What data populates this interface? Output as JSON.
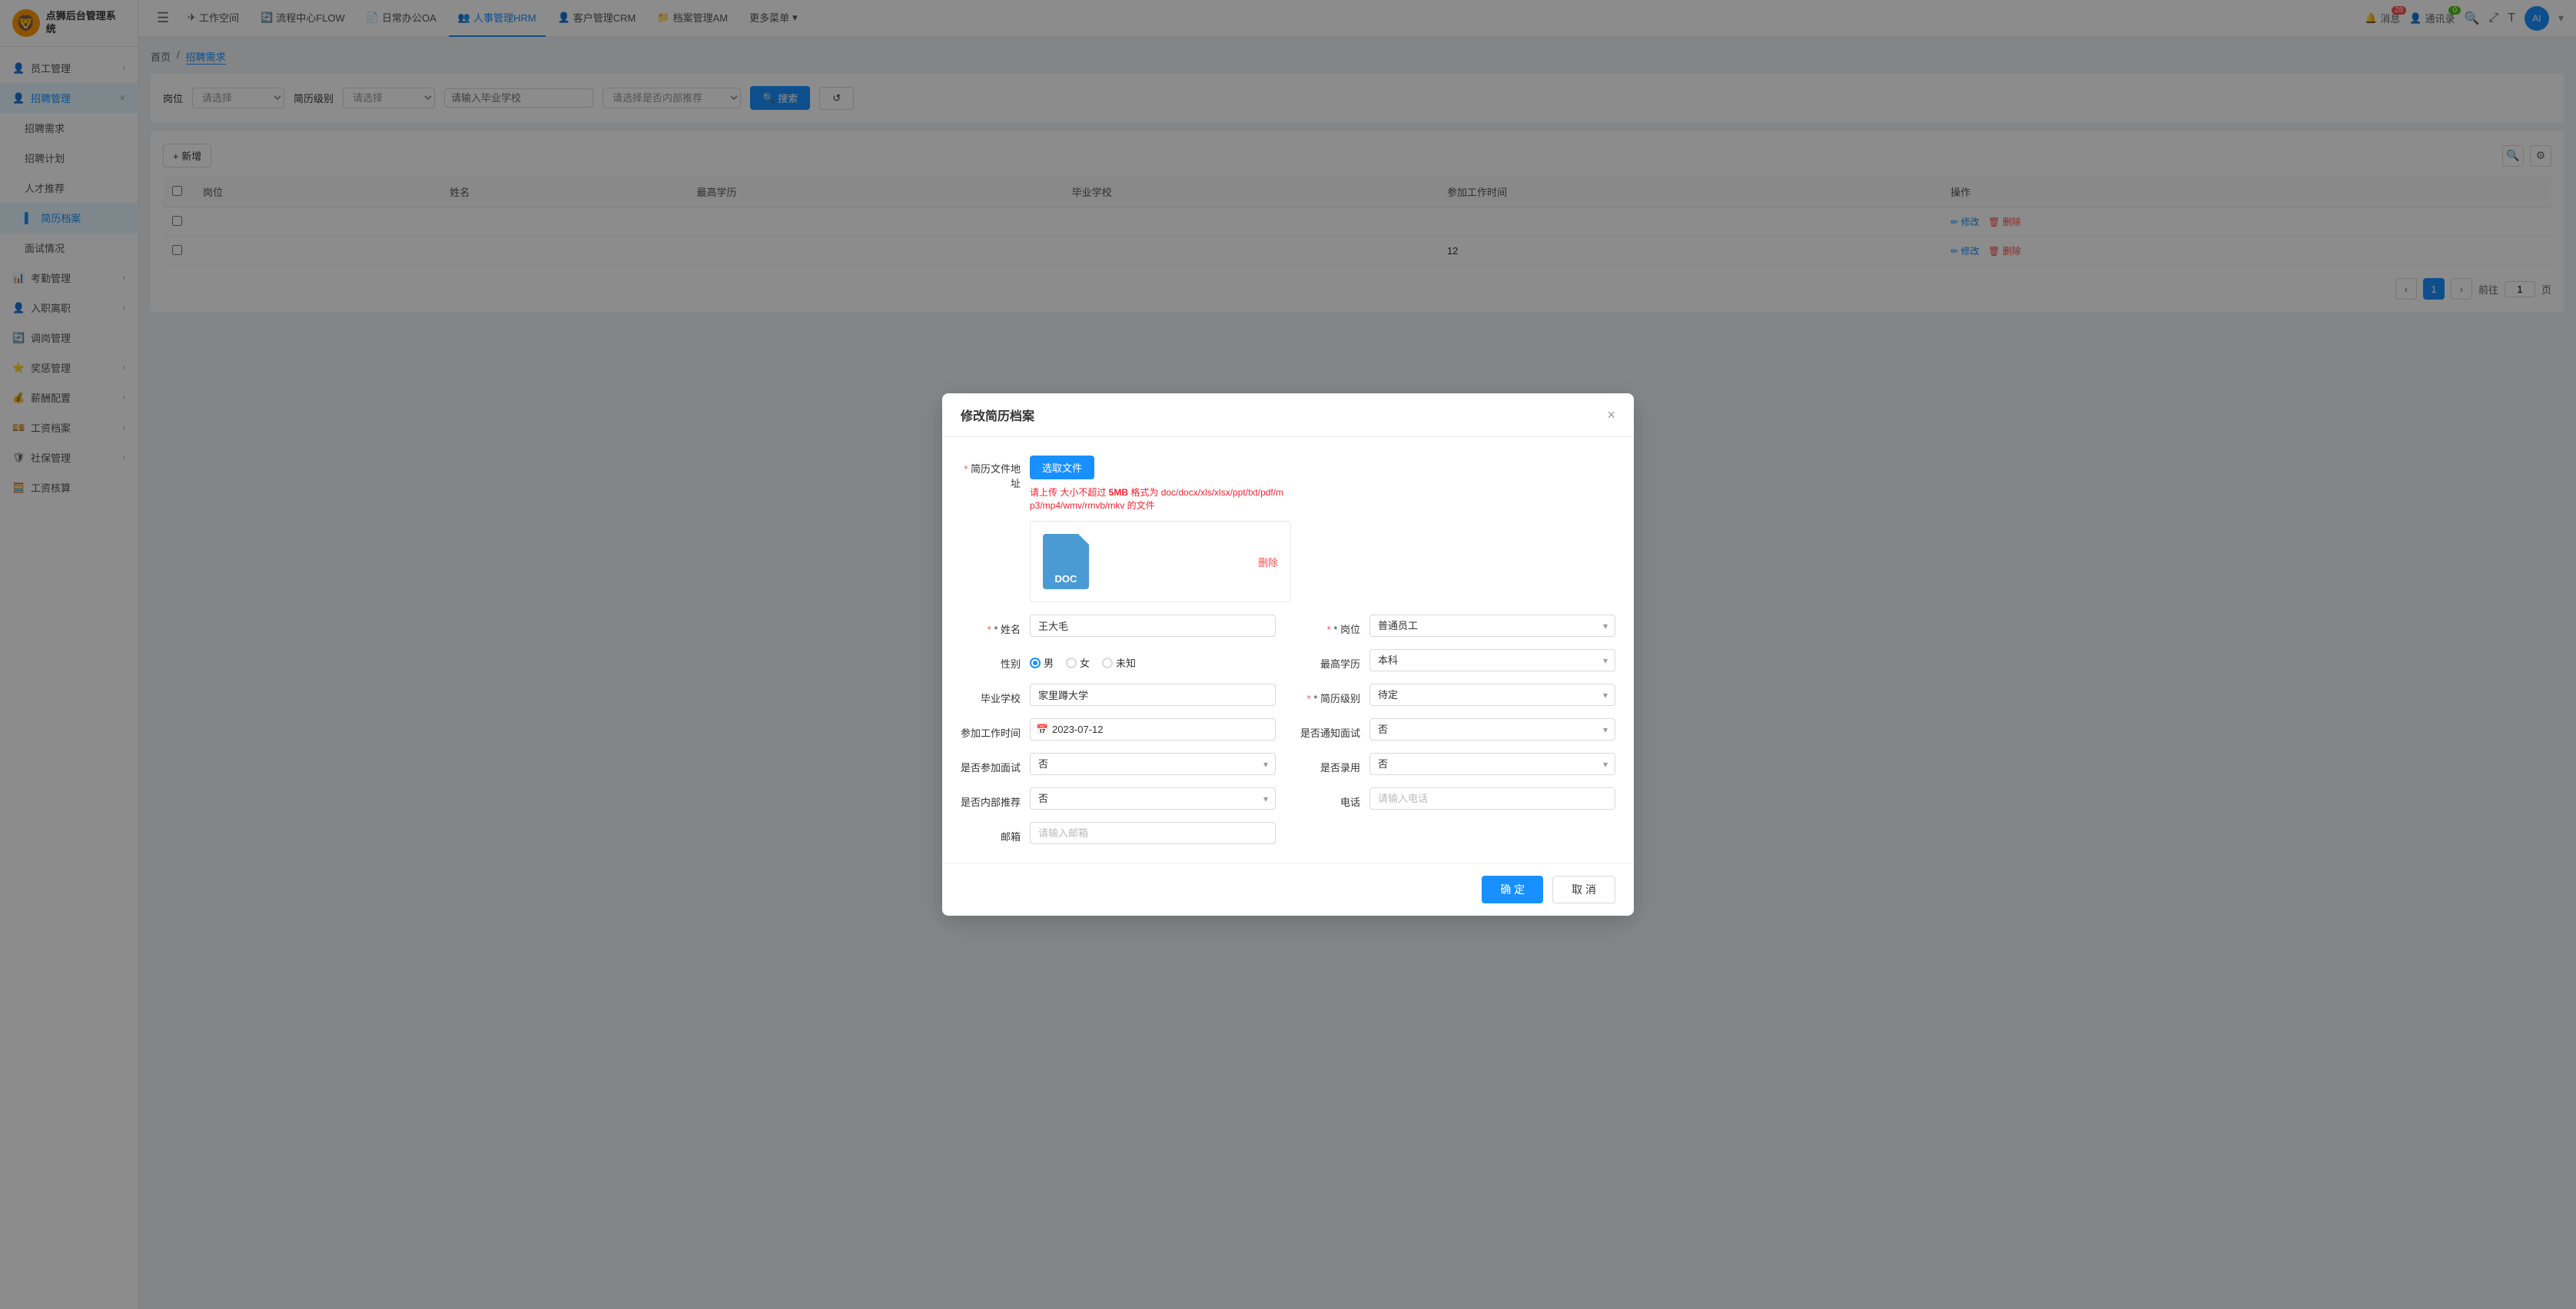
{
  "app": {
    "name": "点狮后台管理系统",
    "logo_emoji": "🦁"
  },
  "topnav": {
    "menu_icon": "☰",
    "items": [
      {
        "id": "workspace",
        "label": "工作空间",
        "icon": "✈",
        "active": false
      },
      {
        "id": "flow",
        "label": "流程中心FLOW",
        "icon": "🔄",
        "active": false
      },
      {
        "id": "oa",
        "label": "日常办公OA",
        "icon": "📄",
        "active": false
      },
      {
        "id": "hrm",
        "label": "人事管理HRM",
        "icon": "👥",
        "active": true
      },
      {
        "id": "crm",
        "label": "客户管理CRM",
        "icon": "👤",
        "active": false
      },
      {
        "id": "am",
        "label": "档案管理AM",
        "icon": "📁",
        "active": false
      },
      {
        "id": "more",
        "label": "更多菜单",
        "icon": "",
        "active": false
      }
    ],
    "notifications": {
      "label": "消息",
      "count": "28"
    },
    "contacts": {
      "label": "通讯录",
      "count": "0"
    },
    "search_icon": "🔍",
    "fullscreen_icon": "⤢",
    "font_icon": "T",
    "avatar_text": "AI"
  },
  "sidebar": {
    "items": [
      {
        "id": "employee",
        "label": "员工管理",
        "icon": "👤",
        "has_arrow": true,
        "active": false
      },
      {
        "id": "recruit",
        "label": "招聘管理",
        "icon": "👤",
        "has_arrow": true,
        "active": true
      },
      {
        "id": "recruit-need",
        "label": "招聘需求",
        "indent": true,
        "active": false
      },
      {
        "id": "recruit-plan",
        "label": "招聘计划",
        "indent": true,
        "active": false
      },
      {
        "id": "talent-recommend",
        "label": "人才推荐",
        "indent": true,
        "active": false
      },
      {
        "id": "resume-file",
        "label": "简历档案",
        "indent": true,
        "active": true
      },
      {
        "id": "interview",
        "label": "面试情况",
        "indent": true,
        "active": false
      },
      {
        "id": "attendance",
        "label": "考勤管理",
        "icon": "📊",
        "has_arrow": true,
        "active": false
      },
      {
        "id": "onboarding",
        "label": "入职离职",
        "icon": "👤",
        "has_arrow": true,
        "active": false
      },
      {
        "id": "transfer",
        "label": "调岗管理",
        "icon": "🔄",
        "has_arrow": false,
        "active": false
      },
      {
        "id": "reward",
        "label": "奖惩管理",
        "icon": "⭐",
        "has_arrow": true,
        "active": false
      },
      {
        "id": "salary-config",
        "label": "薪酬配置",
        "icon": "💰",
        "has_arrow": true,
        "active": false
      },
      {
        "id": "salary-file",
        "label": "工资档案",
        "icon": "💴",
        "has_arrow": true,
        "active": false
      },
      {
        "id": "social",
        "label": "社保管理",
        "icon": "🛡",
        "has_arrow": true,
        "active": false
      },
      {
        "id": "salary-calc",
        "label": "工资核算",
        "icon": "🧮",
        "has_arrow": false,
        "active": false
      }
    ]
  },
  "breadcrumb": {
    "items": [
      "首页",
      "招聘需求"
    ]
  },
  "filter": {
    "position_label": "岗位",
    "position_placeholder": "请选择",
    "level_label": "简历级别",
    "level_placeholder": "请选择",
    "school_placeholder": "请输入毕业学校",
    "internal_label": "是否内部推荐",
    "internal_placeholder": "请选择是否内部推荐",
    "search_btn": "搜索",
    "refresh_btn": "↺"
  },
  "table": {
    "add_btn": "+ 新增",
    "columns": [
      "",
      "岗位",
      "姓名",
      "最高学历",
      "毕业学校",
      "参加工作时间",
      "操作"
    ],
    "rows": [
      {
        "id": 1,
        "position": "",
        "name": "",
        "edu": "",
        "school": "",
        "work_time": "",
        "ops": [
          "修改",
          "删除"
        ]
      },
      {
        "id": 2,
        "position": "",
        "name": "",
        "edu": "",
        "school": "",
        "work_time": "12",
        "ops": [
          "修改",
          "删除"
        ]
      }
    ]
  },
  "pagination": {
    "prev": "‹",
    "next": "›",
    "pages": [
      "1"
    ],
    "goto_label": "前往",
    "page_num": "1",
    "page_suffix": "页"
  },
  "modal": {
    "title": "修改简历档案",
    "close_icon": "×",
    "upload": {
      "label": "简历文件地址",
      "btn": "选取文件",
      "hint1": "请上传 大小不超过 5MB 格式为 doc/docx/xls/xlsx/ppt/txt/pdf/m",
      "hint2": "p3/mp4/wmv/rmvb/mkv 的文件",
      "file_name": "DOC",
      "delete_label": "删除"
    },
    "fields": {
      "name_label": "* 姓名",
      "name_value": "王大毛",
      "position_label": "* 岗位",
      "position_value": "普通员工",
      "gender_label": "性别",
      "gender_options": [
        "男",
        "女",
        "未知"
      ],
      "gender_selected": "男",
      "edu_label": "最高学历",
      "edu_value": "本科",
      "school_label": "毕业学校",
      "school_value": "家里蹲大学",
      "resume_level_label": "* 简历级别",
      "resume_level_value": "待定",
      "work_time_label": "参加工作时间",
      "work_time_value": "2023-07-12",
      "notify_interview_label": "是否通知面试",
      "notify_interview_value": "否",
      "join_interview_label": "是否参加面试",
      "join_interview_value": "否",
      "hired_label": "是否录用",
      "hired_value": "否",
      "internal_label": "是否内部推荐",
      "internal_value": "否",
      "phone_label": "电话",
      "phone_placeholder": "请输入电话",
      "email_label": "邮箱",
      "email_placeholder": "请输入邮箱"
    },
    "confirm_btn": "确 定",
    "cancel_btn": "取 消"
  }
}
